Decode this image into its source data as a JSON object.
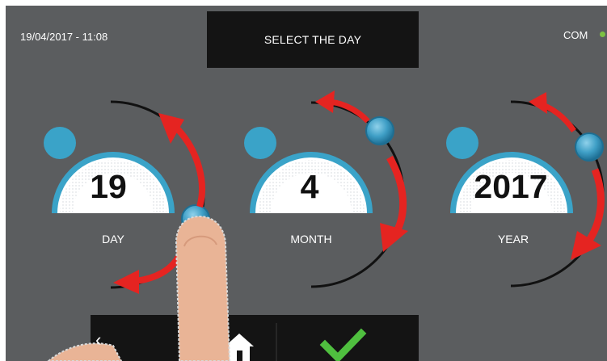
{
  "header": {
    "datetime": "19/04/2017 - 11:08",
    "title": "SELECT THE DAY",
    "connection_label": "COM",
    "connection_color": "#7dc142"
  },
  "dials": [
    {
      "value": "19",
      "label": "DAY"
    },
    {
      "value": "4",
      "label": "MONTH"
    },
    {
      "value": "2017",
      "label": "YEAR"
    }
  ],
  "footer": {
    "back_icon": "chevron-left-icon",
    "home_icon": "home-icon",
    "confirm_icon": "check-icon",
    "confirm_color": "#4fbf3f"
  },
  "colors": {
    "background": "#5b5d5f",
    "panel": "#141414",
    "dial_ring": "#3aa3c8",
    "arrow": "#e52421"
  }
}
